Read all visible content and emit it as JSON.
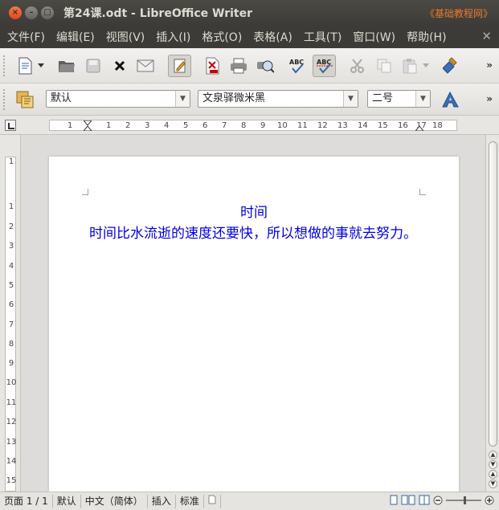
{
  "window": {
    "title": "第24课.odt - LibreOffice Writer",
    "watermark": "《基础教程网》"
  },
  "menubar": {
    "items": [
      {
        "label": "文件(F)",
        "id": "file"
      },
      {
        "label": "编辑(E)",
        "id": "edit"
      },
      {
        "label": "视图(V)",
        "id": "view"
      },
      {
        "label": "插入(I)",
        "id": "insert"
      },
      {
        "label": "格式(O)",
        "id": "format"
      },
      {
        "label": "表格(A)",
        "id": "table"
      },
      {
        "label": "工具(T)",
        "id": "tools"
      },
      {
        "label": "窗口(W)",
        "id": "window"
      },
      {
        "label": "帮助(H)",
        "id": "help"
      }
    ],
    "close_glyph": "✕"
  },
  "toolbar": {
    "more_glyph": "»",
    "icons": [
      "new-document-icon",
      "open-folder-icon",
      "save-icon",
      "close-document-icon",
      "email-icon",
      "edit-mode-icon",
      "export-pdf-icon",
      "print-icon",
      "print-preview-icon",
      "spellcheck-icon",
      "autospellcheck-icon",
      "cut-icon",
      "copy-icon",
      "paste-icon",
      "clone-formatting-icon"
    ]
  },
  "formatting": {
    "paragraph_style": "默认",
    "font_name": "文泉驿微米黑",
    "font_size": "二号",
    "more_glyph": "»"
  },
  "ruler": {
    "h_ticks": [
      "1",
      "1",
      "2",
      "3",
      "4",
      "5",
      "6",
      "7",
      "8",
      "9",
      "10",
      "11",
      "12",
      "13",
      "14",
      "15",
      "16",
      "17",
      "18"
    ],
    "v_ticks": [
      "1",
      "1",
      "2",
      "3",
      "4",
      "5",
      "6",
      "7",
      "8",
      "9",
      "10",
      "11",
      "12",
      "13",
      "14",
      "15"
    ]
  },
  "document": {
    "title": "时间",
    "body": "时间比水流逝的速度还要快，所以想做的事就去努力。"
  },
  "colors": {
    "text": "#0000dd",
    "accent": "#e0481d"
  },
  "status": {
    "page": "页面 1 / 1",
    "style": "默认",
    "language": "中文（简体）",
    "insert_mode": "插入",
    "selection_mode": "标准"
  }
}
